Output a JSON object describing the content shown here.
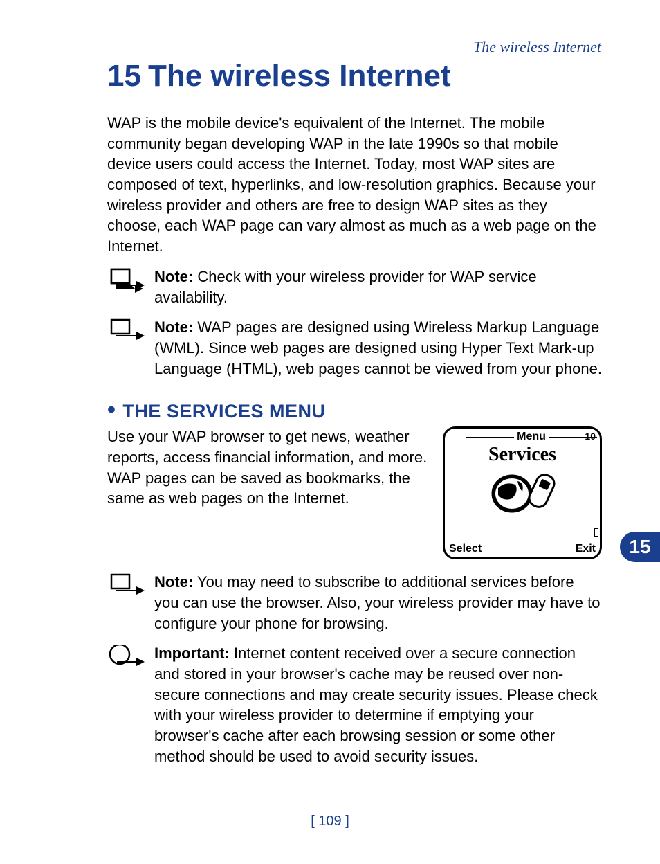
{
  "runningHeader": "The wireless Internet",
  "chapter": {
    "number": "15",
    "title": "The wireless Internet"
  },
  "intro": "WAP is the mobile device's equivalent of the Internet. The mobile community began developing WAP in the late 1990s so that mobile device users could access the Internet. Today, most WAP sites are composed of text, hyperlinks, and low-resolution graphics. Because your wireless provider and others are free to design WAP sites as they choose, each WAP page can vary almost as much as a web page on the Internet.",
  "note1": {
    "label": "Note:",
    "text": " Check with your wireless provider for WAP service availability."
  },
  "note2": {
    "label": "Note:",
    "text": " WAP pages are designed using Wireless Markup Language (WML). Since web pages are designed using Hyper Text Mark-up Language (HTML), web pages cannot be viewed from your phone."
  },
  "section": {
    "heading": "THE SERVICES MENU",
    "body": "Use your WAP browser to get news, weather reports, access financial information, and more. WAP pages can be saved as bookmarks, the same as web pages on the Internet."
  },
  "phone": {
    "topLabel": "Menu",
    "topNum": "10",
    "title": "Services",
    "leftSoft": "Select",
    "rightSoft": "Exit"
  },
  "note3": {
    "label": "Note:",
    "text": " You may need to subscribe to additional services before you can use the browser. Also, your wireless provider may have to configure your phone for browsing."
  },
  "important": {
    "label": "Important:",
    "text": " Internet content received over a secure connection and stored in your browser's cache may be reused over non-secure connections and may create security issues. Please check with your wireless provider to determine if emptying your browser's cache after each browsing session or some other method should be used to avoid security issues."
  },
  "sideTab": "15",
  "pageNumber": "[ 109 ]"
}
